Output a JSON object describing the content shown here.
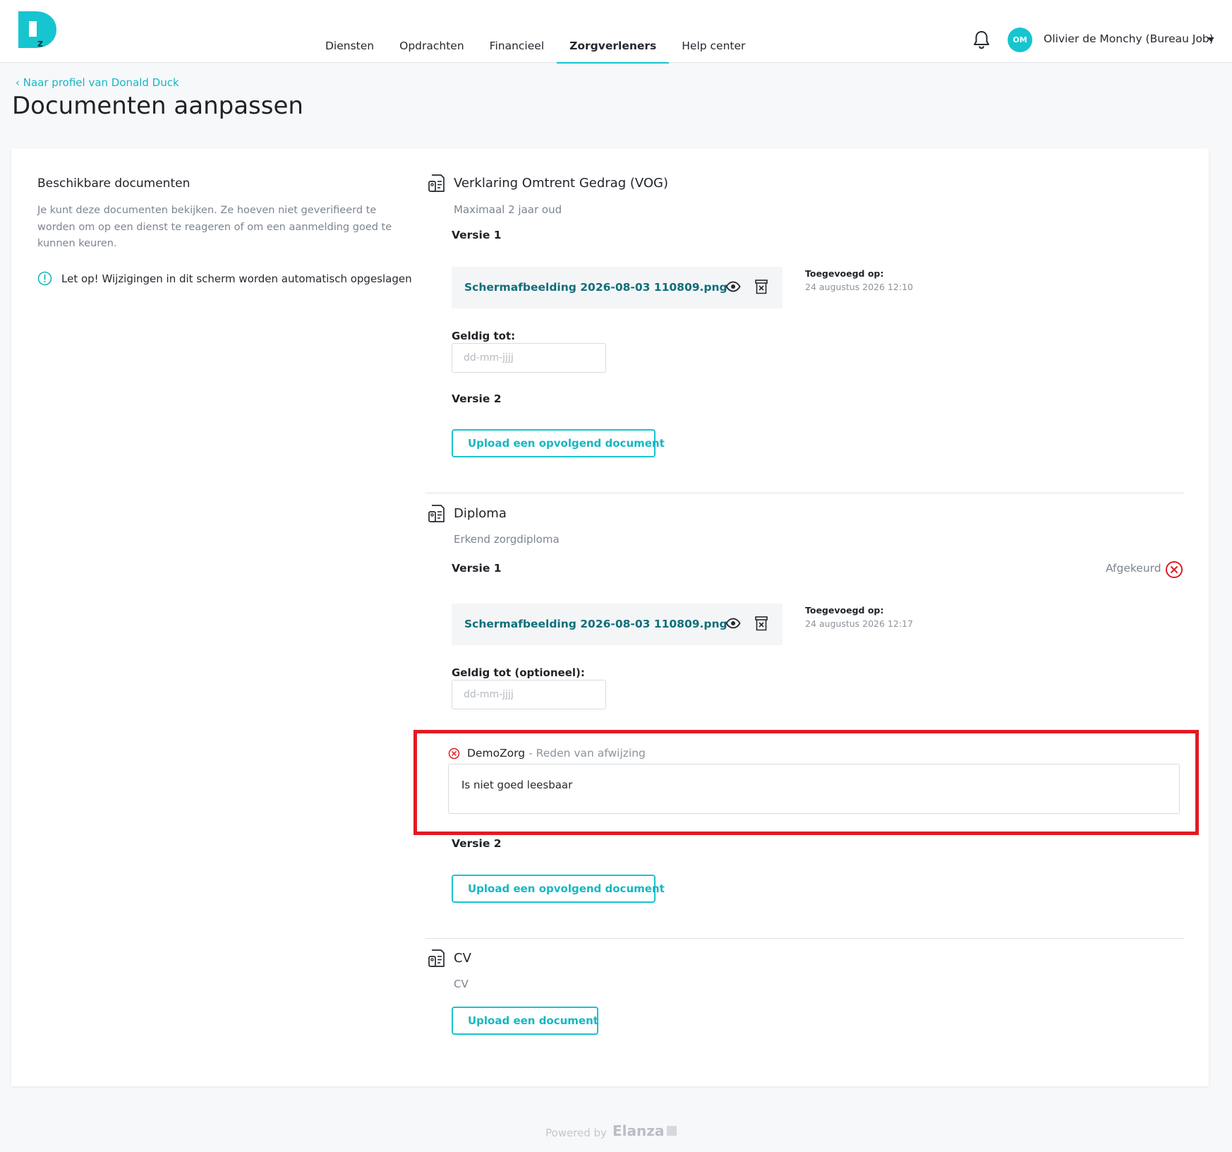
{
  "nav": {
    "items": [
      {
        "label": "Diensten",
        "active": false
      },
      {
        "label": "Opdrachten",
        "active": false
      },
      {
        "label": "Financieel",
        "active": false
      },
      {
        "label": "Zorgverleners",
        "active": true
      },
      {
        "label": "Help center",
        "active": false
      }
    ]
  },
  "user": {
    "initials": "OM",
    "name": "Olivier de Monchy (Bureau Job)"
  },
  "page": {
    "back_link": "‹ Naar profiel van Donald Duck",
    "title": "Documenten aanpassen"
  },
  "sidebar": {
    "title": "Beschikbare documenten",
    "description": "Je kunt deze documenten bekijken. Ze hoeven niet geverifieerd te worden om op een dienst te reageren of om een aanmelding goed te kunnen keuren.",
    "note": "Let op! Wijzigingen in dit scherm worden automatisch opgeslagen"
  },
  "documents": {
    "vog": {
      "title": "Verklaring Omtrent Gedrag (VOG)",
      "subtitle": "Maximaal 2 jaar oud",
      "v1": {
        "label": "Versie 1",
        "file_name": "Schermafbeelding 2026-08-03 110809.png",
        "added_label": "Toegevoegd op:",
        "added_date": "24 augustus 2026 12:10",
        "valid_label": "Geldig tot:",
        "valid_placeholder": "dd-mm-jjjj"
      },
      "v2": {
        "label": "Versie 2",
        "upload_label": "Upload een opvolgend document"
      }
    },
    "diploma": {
      "title": "Diploma",
      "subtitle": "Erkend zorgdiploma",
      "v1": {
        "label": "Versie 1",
        "status": "Afgekeurd",
        "file_name": "Schermafbeelding 2026-08-03 110809.png",
        "added_label": "Toegevoegd op:",
        "added_date": "24 augustus 2026 12:17",
        "valid_label": "Geldig tot (optioneel):",
        "valid_placeholder": "dd-mm-jjjj",
        "rejection": {
          "organisation": "DemoZorg",
          "reason_label": "- Reden van afwijzing",
          "reason": "Is niet goed leesbaar"
        }
      },
      "v2": {
        "label": "Versie 2",
        "upload_label": "Upload een opvolgend document"
      }
    },
    "cv": {
      "title": "CV",
      "subtitle": "CV",
      "upload_label": "Upload een document"
    }
  },
  "footer": {
    "powered_by": "Powered by",
    "brand": "Elanza"
  },
  "colors": {
    "accent": "#16c5cf",
    "link": "#0f6f7a",
    "danger": "#e11b22"
  }
}
